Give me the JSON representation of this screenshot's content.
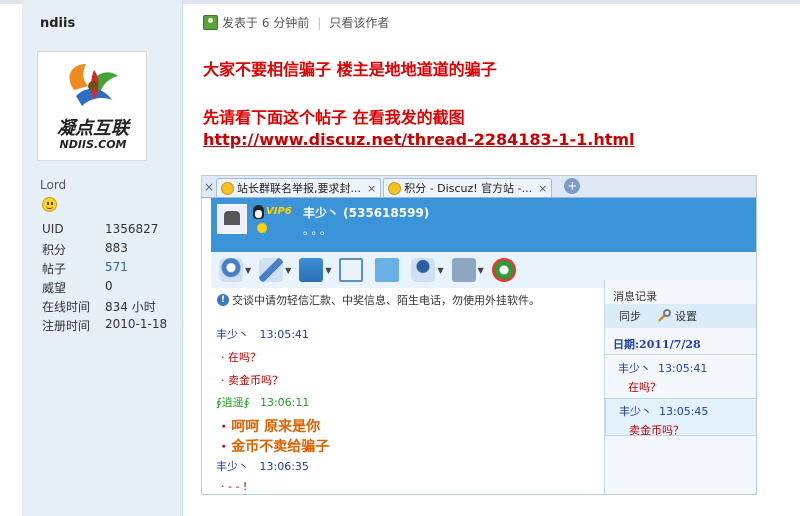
{
  "user": {
    "name": "ndiis",
    "avatar_title": "凝点互联",
    "avatar_sub": "NDIIS.COM",
    "rank": "Lord",
    "stats": [
      {
        "k": "UID",
        "v": "1356827",
        "link": false
      },
      {
        "k": "积分",
        "v": "883",
        "link": false
      },
      {
        "k": "帖子",
        "v": "571",
        "link": true
      },
      {
        "k": "威望",
        "v": "0",
        "link": false
      },
      {
        "k": "在线时间",
        "v": "834 小时",
        "link": false
      },
      {
        "k": "注册时间",
        "v": "2010-1-18",
        "link": false
      }
    ]
  },
  "post": {
    "posted": "发表于 6 分钟前",
    "only_author": "只看该作者",
    "line1": "大家不要相信骗子 楼主是地地道道的骗子",
    "line2": "先请看下面这个帖子  在看我发的截图",
    "url": "http://www.discuz.net/thread-2284183-1-1.html"
  },
  "screenshot": {
    "tabs": [
      {
        "label": "站长群联名举报,要求封..."
      },
      {
        "label": "积分 - Discuz! 官方站 -..."
      }
    ],
    "qq": {
      "vip": "VIP6",
      "name": "丰少丶 (535618599)",
      "dots": "。。。"
    },
    "notice": "交谈中请勿轻信汇款、中奖信息、陌生电话，勿使用外挂软件。",
    "chat": [
      {
        "who": "丰少丶",
        "time": "13:05:41",
        "kind": "blue"
      },
      {
        "text": "在吗？",
        "kind": "red"
      },
      {
        "text": "卖金币吗？",
        "kind": "red"
      },
      {
        "who": "∮逍遥∮",
        "time": "13:06:11",
        "kind": "green"
      },
      {
        "text": "呵呵  原来是你",
        "kind": "big"
      },
      {
        "text": "金币不卖给骗子",
        "kind": "big"
      },
      {
        "who": "丰少丶",
        "time": "13:06:35",
        "kind": "blue"
      },
      {
        "text": "- - !",
        "kind": "red"
      }
    ],
    "history": {
      "title": "消息记录",
      "sync": "同步",
      "settings": "设置",
      "date": "日期:2011/7/28",
      "items": [
        {
          "who": "丰少丶",
          "time": "13:05:41",
          "msg": "在吗？"
        },
        {
          "who": "丰少丶",
          "time": "13:05:45",
          "msg": "卖金币吗？"
        }
      ]
    }
  }
}
